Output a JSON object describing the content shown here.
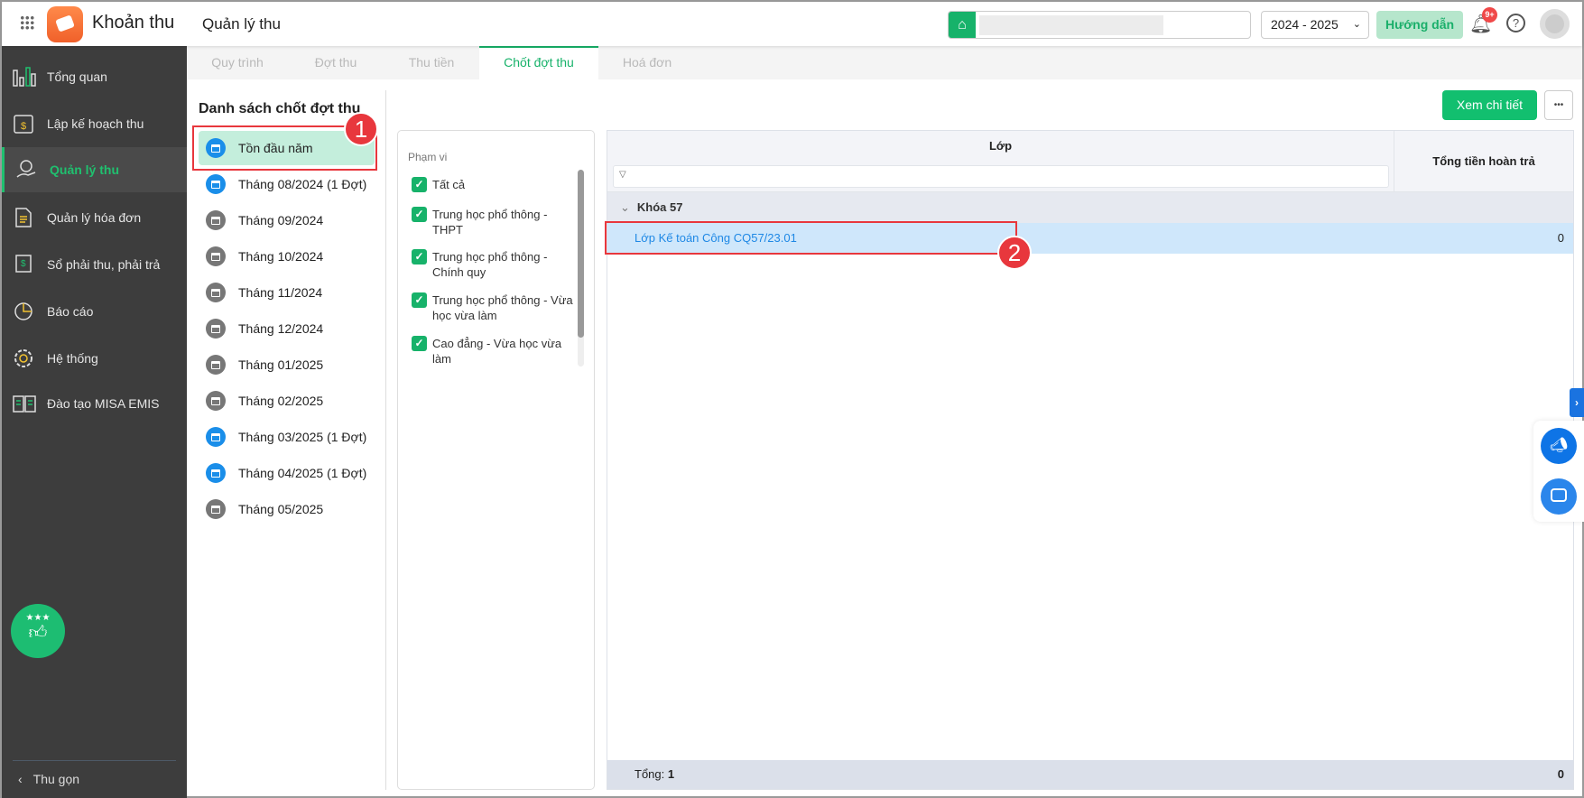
{
  "app": {
    "name": "Khoản thu",
    "page_title": "Quản lý thu"
  },
  "header": {
    "school_year": "2024 - 2025",
    "guide_label": "Hướng dẫn",
    "notification_badge": "9+"
  },
  "sidebar": {
    "items": [
      {
        "label": "Tổng quan"
      },
      {
        "label": "Lập kế hoạch thu"
      },
      {
        "label": "Quản lý thu"
      },
      {
        "label": "Quản lý hóa đơn"
      },
      {
        "label": "Sổ phải thu, phải trả"
      },
      {
        "label": "Báo cáo"
      },
      {
        "label": "Hệ thống"
      },
      {
        "label": "Đào tạo MISA EMIS"
      }
    ],
    "collapse_label": "Thu gọn"
  },
  "tabs": [
    {
      "label": "Quy trình"
    },
    {
      "label": "Đợt thu"
    },
    {
      "label": "Thu tiền"
    },
    {
      "label": "Chốt đợt thu"
    },
    {
      "label": "Hoá đơn"
    }
  ],
  "list": {
    "title": "Danh sách chốt đợt thu",
    "items": [
      {
        "label": "Tồn đầu năm"
      },
      {
        "label": "Tháng 08/2024 (1 Đợt)"
      },
      {
        "label": "Tháng 09/2024"
      },
      {
        "label": "Tháng 10/2024"
      },
      {
        "label": "Tháng 11/2024"
      },
      {
        "label": "Tháng 12/2024"
      },
      {
        "label": "Tháng 01/2025"
      },
      {
        "label": "Tháng 02/2025"
      },
      {
        "label": "Tháng 03/2025 (1 Đợt)"
      },
      {
        "label": "Tháng 04/2025 (1 Đợt)"
      },
      {
        "label": "Tháng 05/2025"
      }
    ]
  },
  "toolbar": {
    "view_detail_label": "Xem chi tiết",
    "more_label": "•••"
  },
  "filter": {
    "title": "Phạm vi",
    "options": [
      {
        "label": "Tất cả"
      },
      {
        "label": "Trung học phổ thông - THPT"
      },
      {
        "label": "Trung học phổ thông - Chính quy"
      },
      {
        "label": "Trung học phổ thông - Vừa học vừa làm"
      },
      {
        "label": "Cao đẳng - Vừa học vừa làm"
      }
    ]
  },
  "table": {
    "columns": [
      "Lớp",
      "Tổng tiền hoàn trả"
    ],
    "group": "Khóa 57",
    "rows": [
      {
        "class": "Lớp Kế toán Công CQ57/23.01",
        "refund": "0"
      }
    ],
    "footer": {
      "label": "Tổng:",
      "count": "1",
      "total": "0"
    }
  },
  "annotations": [
    "1",
    "2"
  ]
}
